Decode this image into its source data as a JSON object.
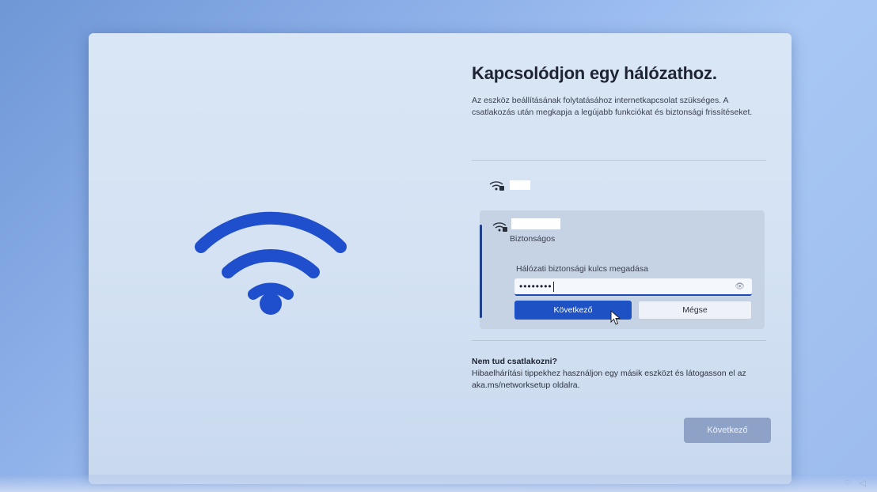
{
  "setup": {
    "title": "Kapcsolódjon egy hálózathoz.",
    "description": "Az eszköz beállításának folytatásához internetkapcsolat szükséges. A csatlakozás után megkapja a legújabb funkciókat és biztonsági frissítéseket.",
    "networks": [
      {
        "ssid": "",
        "icon": "wifi-lock-icon"
      },
      {
        "ssid": "",
        "icon": "wifi-lock-icon",
        "security": "Biztonságos",
        "key_label": "Hálózati biztonsági kulcs megadása",
        "key_value": "••••••••",
        "next_label": "Következő",
        "cancel_label": "Mégse"
      }
    ],
    "help": {
      "heading": "Nem tud csatlakozni?",
      "text": "Hibaelhárítási tippekhez használjon egy másik eszközt és látogasson el az aka.ms/networksetup oldalra."
    },
    "next_button": "Következő"
  },
  "colors": {
    "accent": "#1e52c4",
    "wifi_art": "#1f4fcc",
    "panel": "#d7e4f4"
  },
  "icons": [
    "wifi-large-icon",
    "wifi-lock-icon",
    "reveal-password-icon",
    "mouse-cursor-icon"
  ]
}
